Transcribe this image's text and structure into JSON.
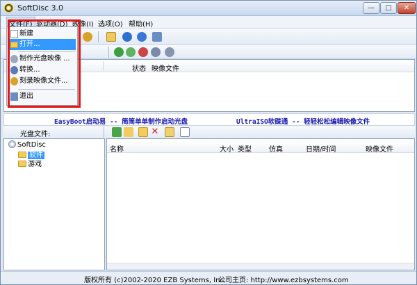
{
  "window": {
    "title": "SoftDisc 3.0",
    "controls": {
      "minimize": "—",
      "maximize": "□",
      "close": "✕"
    }
  },
  "menubar": {
    "file": "文件(F)",
    "drive": "驱动器(D)",
    "image": "映像(I)",
    "options": "选项(O)",
    "help": "帮助(H)"
  },
  "file_menu": {
    "items": [
      "新建",
      "打开...",
      "制作光盘映像 ...",
      "转换...",
      "刻录映像文件...",
      "退出"
    ],
    "highlighted_index": 1
  },
  "upper_list": {
    "columns": [
      "状态",
      "映像文件"
    ]
  },
  "banner": {
    "left": "EasyBoot启动易 -- 简简单单制作启动光盘",
    "right": "UltraISO软碟通 -- 轻轻松松编辑映像文件"
  },
  "lower": {
    "label": "光盘文件:",
    "tree": {
      "root": "SoftDisc",
      "children": [
        "软件",
        "游戏"
      ],
      "selected": "软件"
    },
    "file_columns": [
      "名称",
      "大小",
      "类型",
      "仿真",
      "日期/时间",
      "映像文件"
    ]
  },
  "statusbar": {
    "copyright": "版权所有 (c)2002-2020 EZB Systems, Inc.",
    "homepage": "公司主页: http://www.ezbsystems.com"
  },
  "colors": {
    "highlight": "#3399ff",
    "annotation_box": "#e01818",
    "banner_text": "#1a1ab0"
  }
}
